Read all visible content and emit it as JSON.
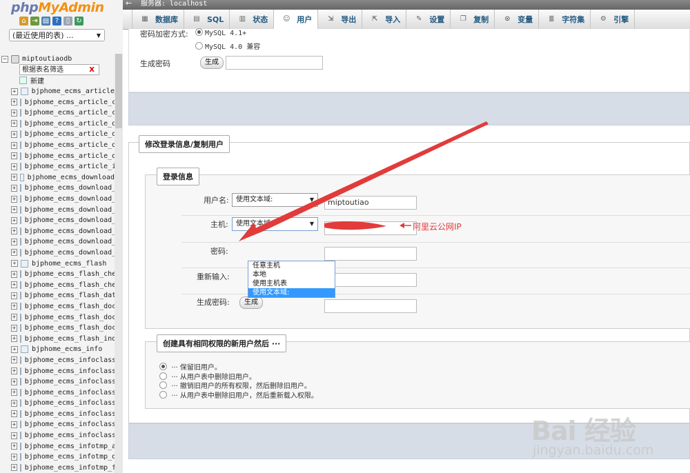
{
  "app": {
    "logo_php": "php",
    "logo_myadmin": "MyAdmin",
    "server_label": "服务器: localhost"
  },
  "nav": {
    "recent_select": "(最近使用的表) ...",
    "database": "miptoutiaodb",
    "filter_placeholder": "根据表名筛选",
    "new_label": "新建",
    "tables": [
      "bjphome_ecms_article",
      "bjphome_ecms_article_ch",
      "bjphome_ecms_article_ch",
      "bjphome_ecms_article_da",
      "bjphome_ecms_article_do",
      "bjphome_ecms_article_do",
      "bjphome_ecms_article_do",
      "bjphome_ecms_article_in",
      "bjphome_ecms_download",
      "bjphome_ecms_download_c",
      "bjphome_ecms_download_c",
      "bjphome_ecms_download_d",
      "bjphome_ecms_download_d",
      "bjphome_ecms_download_d",
      "bjphome_ecms_download_d",
      "bjphome_ecms_download_i",
      "bjphome_ecms_flash",
      "bjphome_ecms_flash_chec",
      "bjphome_ecms_flash_chec",
      "bjphome_ecms_flash_data",
      "bjphome_ecms_flash_doc",
      "bjphome_ecms_flash_doc_",
      "bjphome_ecms_flash_doc_",
      "bjphome_ecms_flash_inde",
      "bjphome_ecms_info",
      "bjphome_ecms_infoclass_",
      "bjphome_ecms_infoclass_",
      "bjphome_ecms_infoclass_",
      "bjphome_ecms_infoclass_",
      "bjphome_ecms_infoclass_",
      "bjphome_ecms_infoclass_",
      "bjphome_ecms_infoclass_",
      "bjphome_ecms_infoclass_",
      "bjphome_ecms_infotmp_ar",
      "bjphome_ecms_infotmp_do",
      "bjphome_ecms_infotmp_fl"
    ]
  },
  "tabs": [
    {
      "label": "数据库",
      "icon": "database-icon"
    },
    {
      "label": "SQL",
      "icon": "sql-icon"
    },
    {
      "label": "状态",
      "icon": "status-icon"
    },
    {
      "label": "用户",
      "icon": "users-icon"
    },
    {
      "label": "导出",
      "icon": "export-icon"
    },
    {
      "label": "导入",
      "icon": "import-icon"
    },
    {
      "label": "设置",
      "icon": "settings-icon"
    },
    {
      "label": "复制",
      "icon": "replication-icon"
    },
    {
      "label": "变量",
      "icon": "variables-icon"
    },
    {
      "label": "字符集",
      "icon": "charset-icon"
    },
    {
      "label": "引擎",
      "icon": "engines-icon"
    }
  ],
  "password_section": {
    "hash_label": "密码加密方式:",
    "opt_41": "MySQL 4.1+",
    "opt_40": "MySQL 4.0 兼容",
    "generate_label": "生成密码",
    "generate_button": "生成"
  },
  "edit": {
    "legend": "修改登录信息/复制用户",
    "login_legend": "登录信息",
    "username_label": "用户名:",
    "username_select": "使用文本域:",
    "username_value": "miptoutiao",
    "host_label": "主机:",
    "host_select": "使用文本域:",
    "password_label": "密码:",
    "reenter_label": "重新输入:",
    "genpass_label": "生成密码:",
    "genpass_button": "生成",
    "host_options": [
      "任意主机",
      "本地",
      "使用主机表",
      "使用文本域:"
    ]
  },
  "create": {
    "legend": "创建具有相同权限的新用户然后 ···",
    "options": [
      "··· 保留旧用户。",
      "··· 从用户表中删除旧用户。",
      "··· 撤销旧用户的所有权限，然后删除旧用户。",
      "··· 从用户表中删除旧用户，然后重新载入权限。"
    ]
  },
  "annotation": {
    "label": "阿里云公网IP",
    "color": "#e23b3b"
  },
  "watermark": {
    "brand": "Bai 经验",
    "url": "jingyan.baidu.com"
  }
}
